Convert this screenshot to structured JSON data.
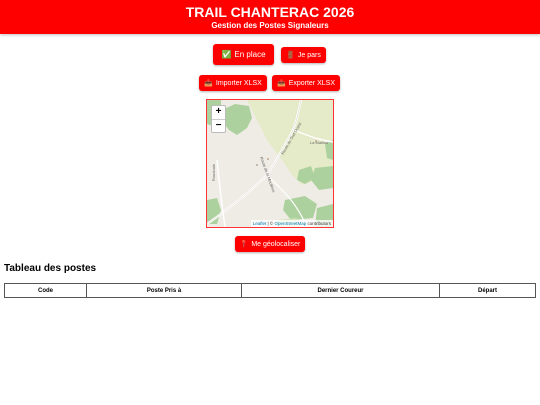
{
  "header": {
    "title": "TRAIL CHANTERAC 2026",
    "subtitle": "Gestion des Postes Signaleurs"
  },
  "actions": {
    "en_place": {
      "icon": "✅",
      "label": "En place"
    },
    "je_pars": {
      "icon": "🚪",
      "label": "Je pars"
    },
    "importer": {
      "icon": "📥",
      "label": "Importer XLSX"
    },
    "exporter": {
      "icon": "📤",
      "label": "Exporter XLSX"
    },
    "geoloc": {
      "icon": "📍",
      "label": "Me géolocaliser"
    }
  },
  "map": {
    "zoom_in": "+",
    "zoom_out": "−",
    "attribution": {
      "leaflet": "Leaflet",
      "separator": " | © ",
      "osm": "OpenStreetMap",
      "contributors": " contributors"
    },
    "place_labels": {
      "road1": "Route du Sud Ouest",
      "town": "La Maillou",
      "road2": "Route de la Mouliève",
      "road3": "Roudoule"
    }
  },
  "table": {
    "title": "Tableau des postes",
    "columns": [
      "Code",
      "Poste Pris à",
      "Dernier Coureur",
      "Départ"
    ]
  },
  "colors": {
    "primary": "#ff0000",
    "map_green": "#add19e",
    "map_land": "#efece6",
    "map_field": "#e5ebc8"
  }
}
